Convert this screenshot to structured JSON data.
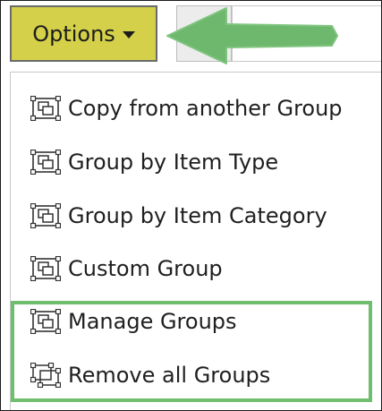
{
  "toolbar": {
    "options_label": "Options"
  },
  "menu": {
    "items": [
      {
        "label": "Copy from another Group",
        "icon": "group-icon"
      },
      {
        "label": "Group by Item Type",
        "icon": "group-icon"
      },
      {
        "label": "Group by Item Category",
        "icon": "group-icon"
      },
      {
        "label": "Custom Group",
        "icon": "group-icon"
      },
      {
        "label": "Manage Groups",
        "icon": "group-icon"
      },
      {
        "label": "Remove all Groups",
        "icon": "ungroup-icon"
      }
    ]
  },
  "colors": {
    "options_button_bg": "#d4d04a",
    "highlight_green": "#6fbe6f",
    "arrow_green": "#6db86d"
  }
}
